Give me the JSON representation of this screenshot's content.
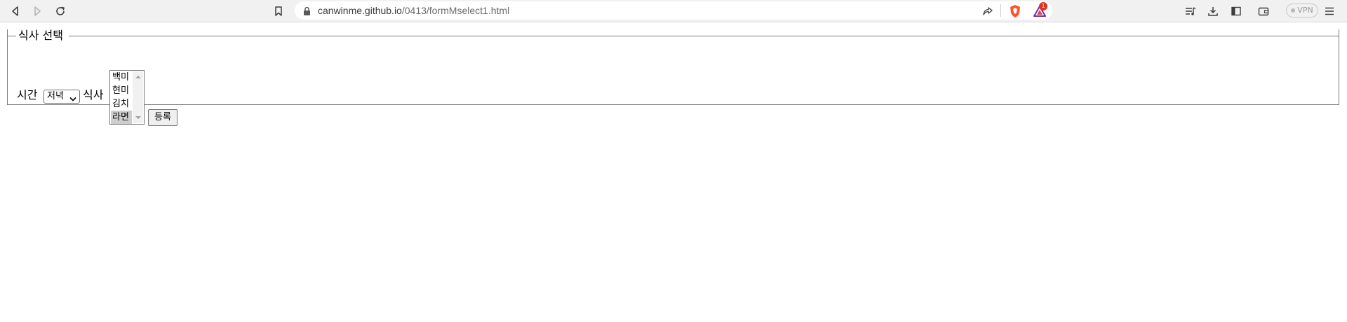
{
  "browser": {
    "url_host": "canwinme.github.io",
    "url_path": "/0413/formMselect1.html",
    "rewards_badge_count": "1",
    "vpn_label": "VPN",
    "icons": [
      "back-icon",
      "forward-icon",
      "reload-icon",
      "bookmark-icon",
      "lock-icon",
      "share-icon",
      "brave-shields-icon",
      "brave-rewards-icon",
      "playlist-icon",
      "download-icon",
      "sidebar-icon",
      "wallet-icon",
      "menu-icon"
    ]
  },
  "form": {
    "legend": "식사 선택",
    "time_label": "시간",
    "time_selected": "저녁",
    "meal_label": "식사",
    "meal_options": [
      "백미",
      "현미",
      "김치",
      "라면"
    ],
    "meal_selected": "라면",
    "submit_label": "등록"
  },
  "colors": {
    "chrome_bg": "#f1f1f1",
    "selected_option_bg": "#cecece",
    "brave_orange": "#fb542b",
    "rewards_badge": "#e0321c"
  }
}
